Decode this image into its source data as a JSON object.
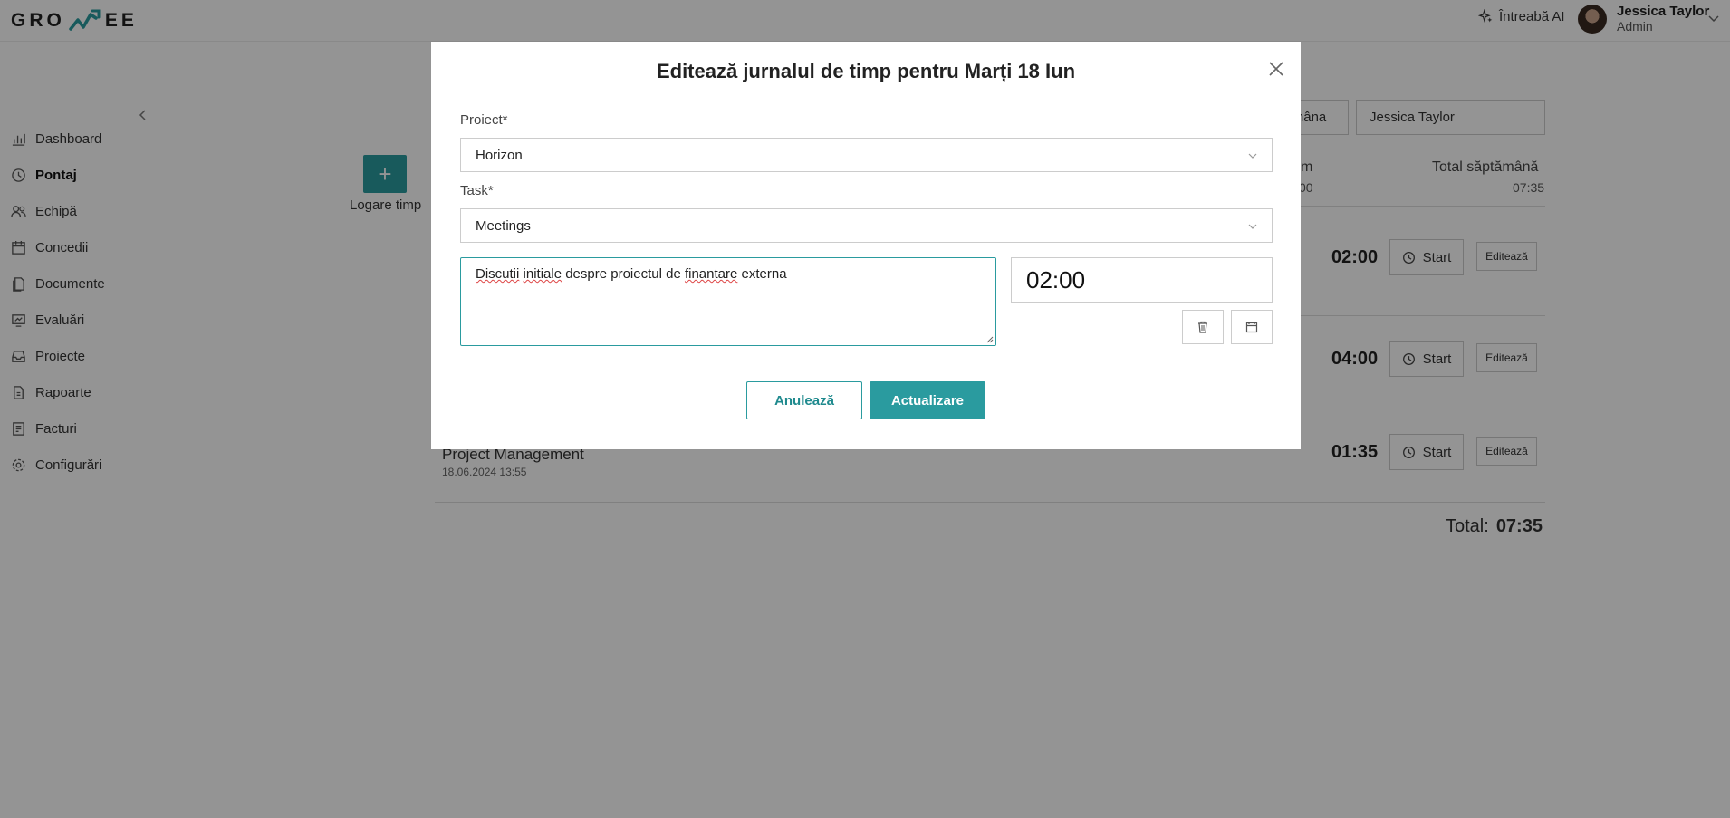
{
  "app": {
    "logo_text_left": "GRO",
    "logo_text_right": "EE",
    "ask_ai": "Întreabă AI",
    "user": {
      "name": "Jessica Taylor",
      "role": "Admin"
    }
  },
  "sidebar": {
    "items": [
      {
        "label": "Dashboard",
        "icon": "chart-icon"
      },
      {
        "label": "Pontaj",
        "icon": "clock-icon",
        "active": true
      },
      {
        "label": "Echipă",
        "icon": "users-icon"
      },
      {
        "label": "Concedii",
        "icon": "calendar-icon"
      },
      {
        "label": "Documente",
        "icon": "documents-icon"
      },
      {
        "label": "Evaluări",
        "icon": "evaluation-icon"
      },
      {
        "label": "Proiecte",
        "icon": "inbox-icon"
      },
      {
        "label": "Rapoarte",
        "icon": "report-icon"
      },
      {
        "label": "Facturi",
        "icon": "invoice-icon"
      },
      {
        "label": "Configurări",
        "icon": "gear-icon"
      }
    ]
  },
  "main": {
    "log_button_label": "Logare timp",
    "week_button_label": "mâna",
    "user_filter": "Jessica Taylor",
    "col_day_head": "m",
    "col_day_value": "00",
    "col_week_head": "Total săptămână",
    "col_week_value": "07:35",
    "rows": [
      {
        "duration": "02:00",
        "start": "Start",
        "edit": "Editează"
      },
      {
        "duration": "04:00",
        "start": "Start",
        "edit": "Editează"
      },
      {
        "duration": "01:35",
        "start": "Start",
        "edit": "Editează",
        "title": "Project Management",
        "date": "18.06.2024 13:55"
      }
    ],
    "total_label": "Total:",
    "total_value": "07:35"
  },
  "modal": {
    "title": "Editează jurnalul de timp pentru Marți 18 Iun",
    "project_label": "Proiect*",
    "project_value": "Horizon",
    "task_label": "Task*",
    "task_value": "Meetings",
    "description_parts": [
      "Discutii",
      " ",
      "initiale",
      " despre proiectul de ",
      "finantare",
      " externa"
    ],
    "time_value": "02:00",
    "cancel_label": "Anulează",
    "update_label": "Actualizare"
  },
  "colors": {
    "accent": "#2a9b9f",
    "overlay": "rgba(0,0,0,0.42)"
  }
}
